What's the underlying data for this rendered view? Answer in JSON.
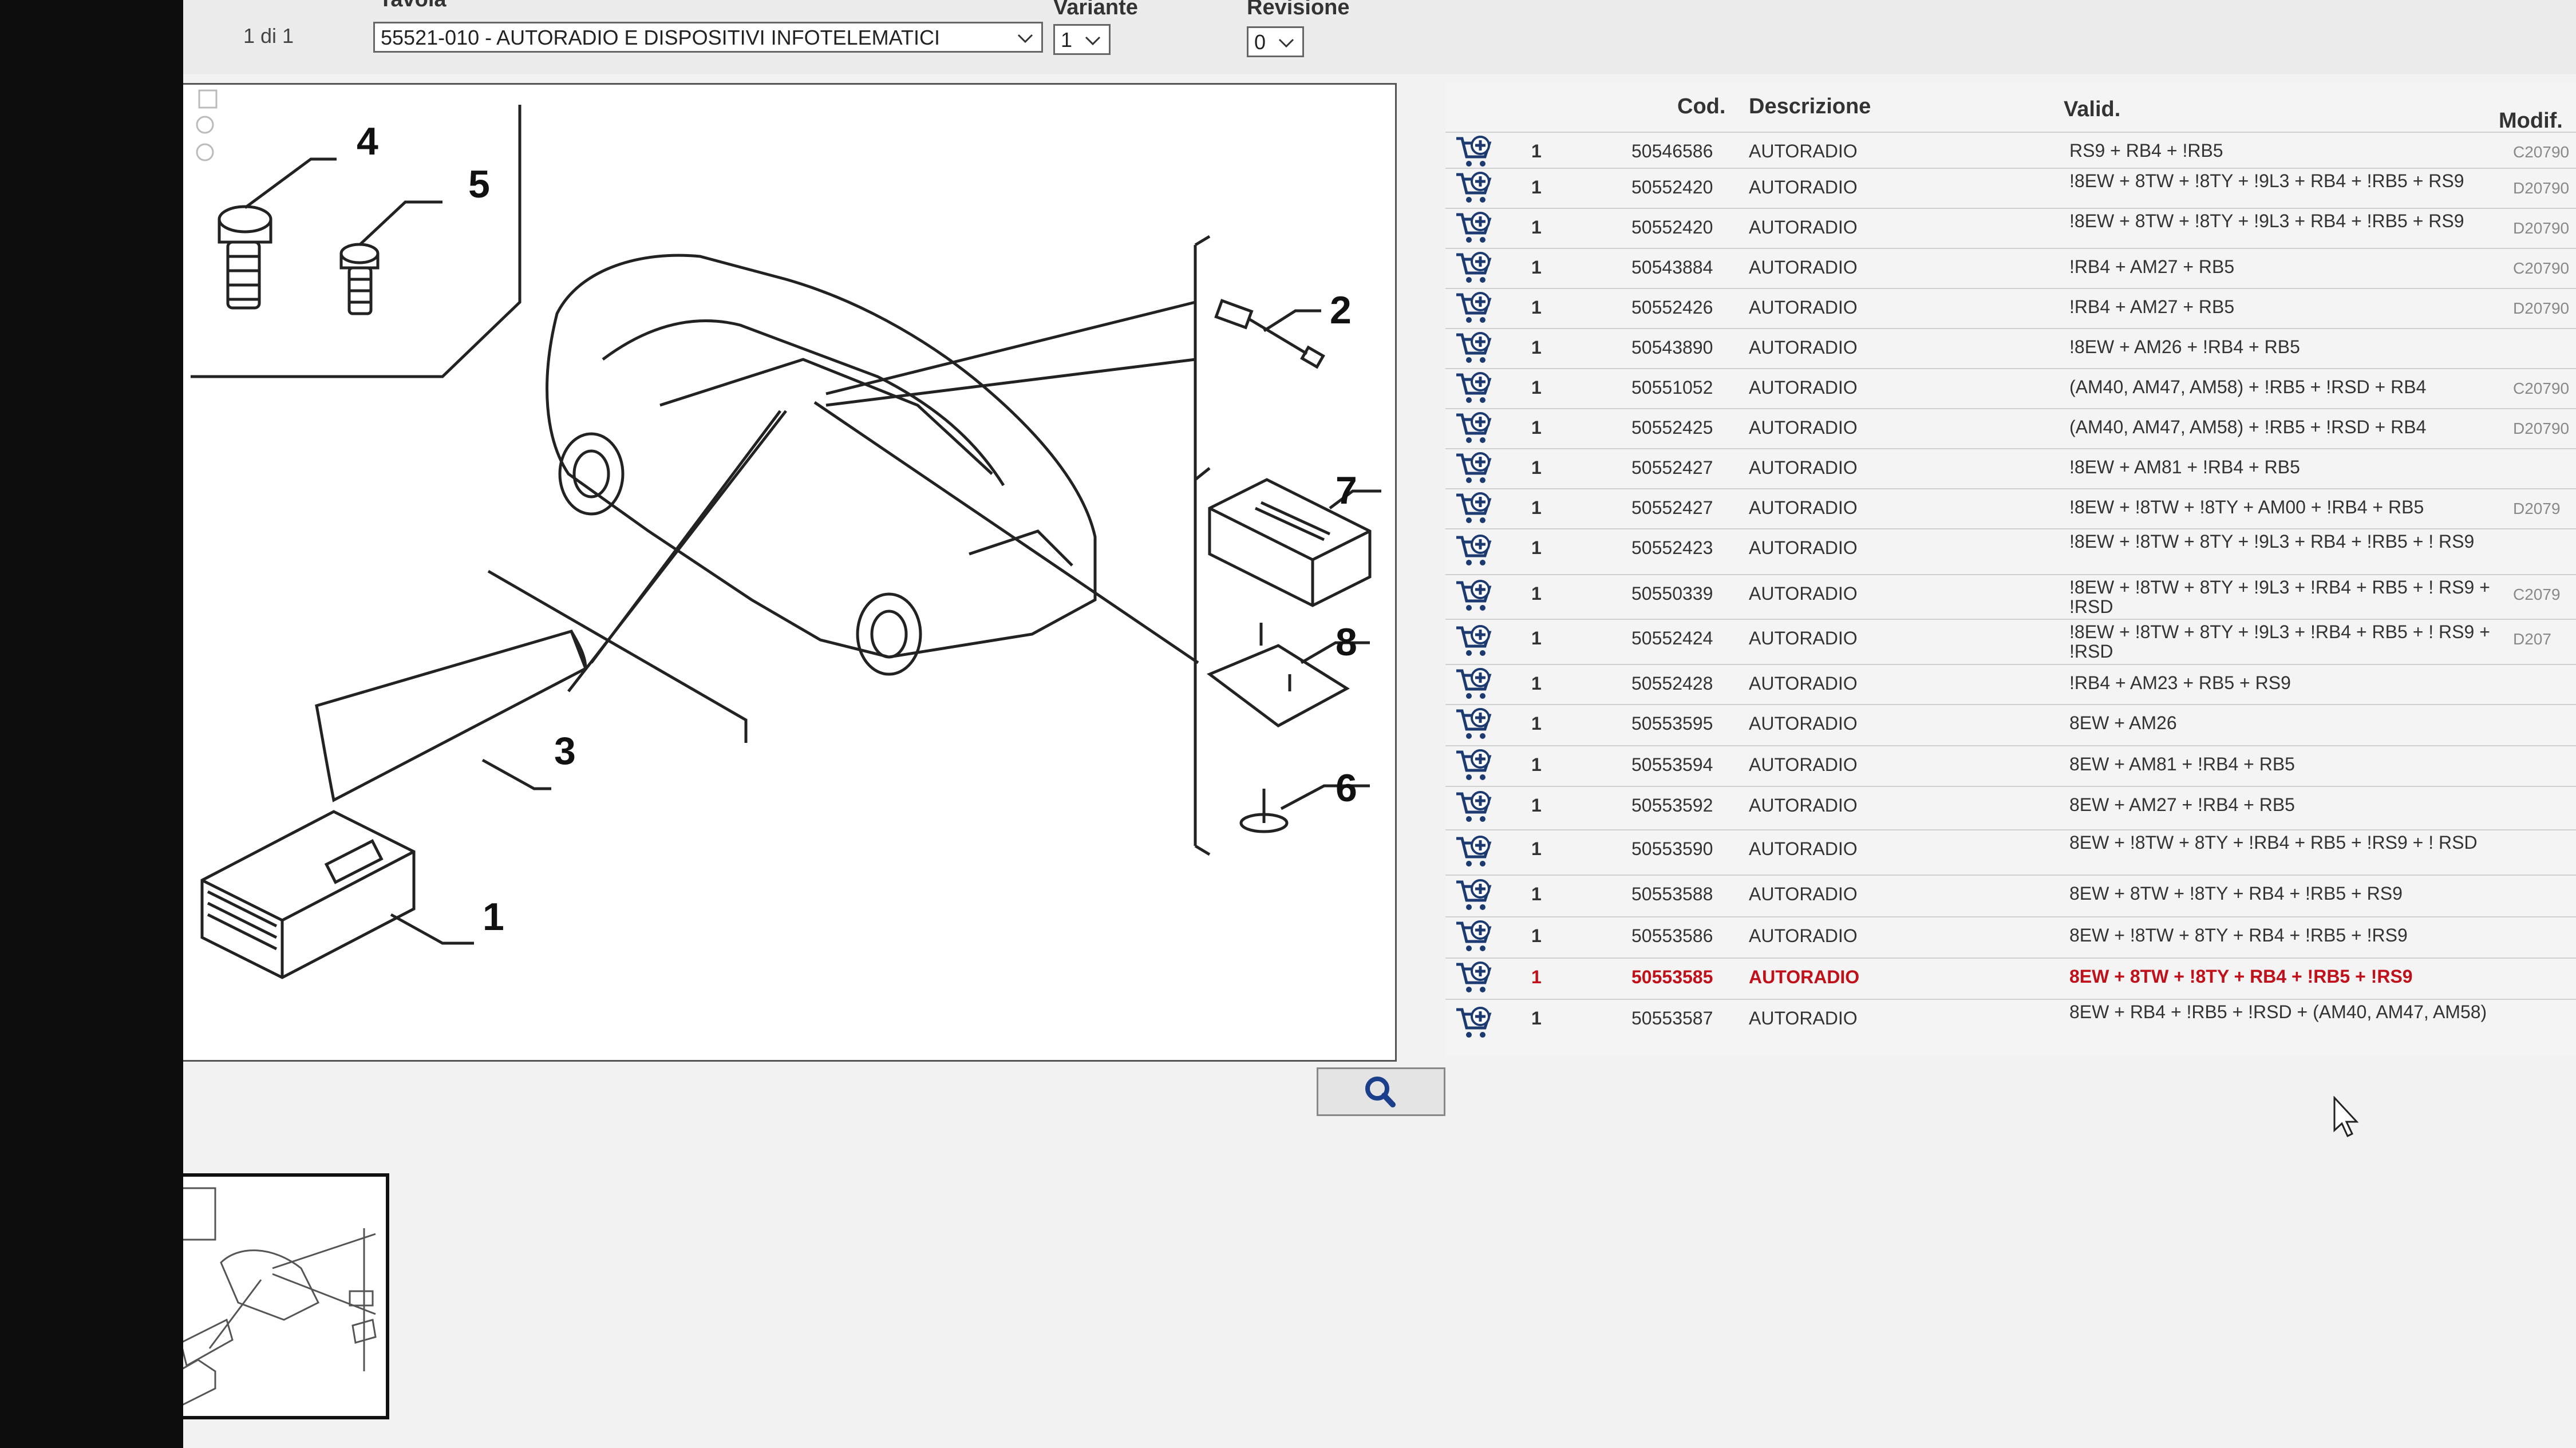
{
  "header": {
    "page_count": "1 di 1",
    "tavola_label": "Tavola",
    "tavola_value": "55521-010 - AUTORADIO E DISPOSITIVI INFOTELEMATICI",
    "variante_label": "Variante",
    "variante_value": "1",
    "revisione_label": "Revisione",
    "revisione_value": "0"
  },
  "diagram": {
    "callouts": [
      "4",
      "5",
      "2",
      "7",
      "8",
      "3",
      "6",
      "1"
    ]
  },
  "table": {
    "headers": {
      "cod": "Cod.",
      "descrizione": "Descrizione",
      "valid": "Valid.",
      "modif": "Modif."
    },
    "rows": [
      {
        "qty": "1",
        "code": "50546586",
        "desc": "AUTORADIO",
        "valid": "RS9 + RB4 + !RB5",
        "modif": "C20790"
      },
      {
        "qty": "1",
        "code": "50552420",
        "desc": "AUTORADIO",
        "valid": "!8EW + 8TW + !8TY + !9L3 + RB4 + !RB5 + RS9",
        "modif": "D20790"
      },
      {
        "qty": "1",
        "code": "50552420",
        "desc": "AUTORADIO",
        "valid": "!8EW + 8TW + !8TY + !9L3 + RB4 + !RB5 + RS9",
        "modif": "D20790"
      },
      {
        "qty": "1",
        "code": "50543884",
        "desc": "AUTORADIO",
        "valid": "!RB4 + AM27 + RB5",
        "modif": "C20790"
      },
      {
        "qty": "1",
        "code": "50552426",
        "desc": "AUTORADIO",
        "valid": "!RB4 + AM27 + RB5",
        "modif": "D20790"
      },
      {
        "qty": "1",
        "code": "50543890",
        "desc": "AUTORADIO",
        "valid": "!8EW + AM26 + !RB4 + RB5",
        "modif": ""
      },
      {
        "qty": "1",
        "code": "50551052",
        "desc": "AUTORADIO",
        "valid": "(AM40, AM47, AM58) + !RB5 + !RSD + RB4",
        "modif": "C20790"
      },
      {
        "qty": "1",
        "code": "50552425",
        "desc": "AUTORADIO",
        "valid": "(AM40, AM47, AM58) + !RB5 + !RSD + RB4",
        "modif": "D20790"
      },
      {
        "qty": "1",
        "code": "50552427",
        "desc": "AUTORADIO",
        "valid": "!8EW + AM81 + !RB4 + RB5",
        "modif": ""
      },
      {
        "qty": "1",
        "code": "50552427",
        "desc": "AUTORADIO",
        "valid": "!8EW + !8TW + !8TY + AM00 + !RB4 + RB5",
        "modif": "D2079"
      },
      {
        "qty": "1",
        "code": "50552423",
        "desc": "AUTORADIO",
        "valid": "!8EW + !8TW + 8TY + !9L3 + RB4 + !RB5 + ! RS9",
        "modif": ""
      },
      {
        "qty": "1",
        "code": "50550339",
        "desc": "AUTORADIO",
        "valid": "!8EW + !8TW + 8TY + !9L3 + !RB4 + RB5 + ! RS9 + !RSD",
        "modif": "C2079"
      },
      {
        "qty": "1",
        "code": "50552424",
        "desc": "AUTORADIO",
        "valid": "!8EW + !8TW + 8TY + !9L3 + !RB4 + RB5 + ! RS9 + !RSD",
        "modif": "D207"
      },
      {
        "qty": "1",
        "code": "50552428",
        "desc": "AUTORADIO",
        "valid": "!RB4 + AM23 + RB5 + RS9",
        "modif": ""
      },
      {
        "qty": "1",
        "code": "50553595",
        "desc": "AUTORADIO",
        "valid": "8EW + AM26",
        "modif": ""
      },
      {
        "qty": "1",
        "code": "50553594",
        "desc": "AUTORADIO",
        "valid": "8EW + AM81 + !RB4 + RB5",
        "modif": ""
      },
      {
        "qty": "1",
        "code": "50553592",
        "desc": "AUTORADIO",
        "valid": "8EW + AM27 + !RB4 + RB5",
        "modif": ""
      },
      {
        "qty": "1",
        "code": "50553590",
        "desc": "AUTORADIO",
        "valid": "8EW + !8TW + 8TY + !RB4 + RB5 + !RS9 + ! RSD",
        "modif": ""
      },
      {
        "qty": "1",
        "code": "50553588",
        "desc": "AUTORADIO",
        "valid": "8EW + 8TW + !8TY + RB4 + !RB5 + RS9",
        "modif": ""
      },
      {
        "qty": "1",
        "code": "50553586",
        "desc": "AUTORADIO",
        "valid": "8EW + !8TW + 8TY + RB4 + !RB5 + !RS9",
        "modif": ""
      },
      {
        "qty": "1",
        "code": "50553585",
        "desc": "AUTORADIO",
        "valid": "8EW + 8TW + !8TY + RB4 + !RB5 + !RS9",
        "modif": "",
        "highlight": true
      },
      {
        "qty": "1",
        "code": "50553587",
        "desc": "AUTORADIO",
        "valid": "8EW + RB4 + !RB5 + !RSD + (AM40, AM47, AM58)",
        "modif": ""
      }
    ]
  },
  "colors": {
    "highlight": "#c0111a",
    "cart_icon": "#1d3a70",
    "search_icon": "#1b3f8a"
  },
  "icons": {
    "row_action": "add-to-cart-icon",
    "search": "magnifier-icon",
    "select": "chevron-down-icon"
  }
}
